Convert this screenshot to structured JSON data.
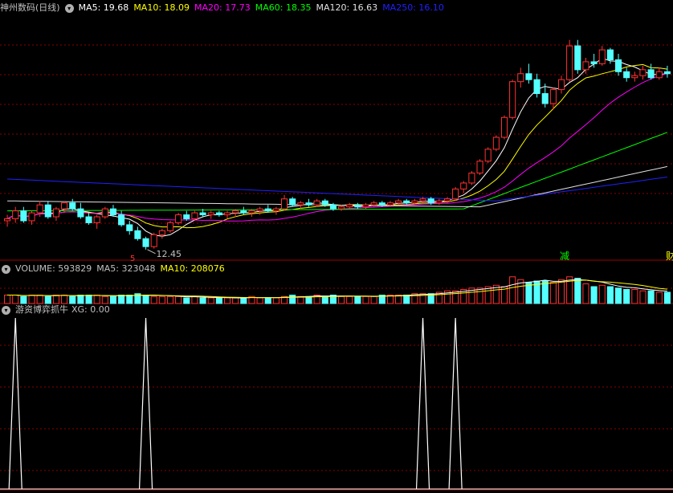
{
  "main_panel": {
    "title": "神州数码(日线)",
    "ma": [
      {
        "label": "MA5: 19.68",
        "color": "#ffffff"
      },
      {
        "label": "MA10: 18.09",
        "color": "#ffff00"
      },
      {
        "label": "MA20: 17.73",
        "color": "#ff00ff"
      },
      {
        "label": "MA60: 18.35",
        "color": "#00ff00"
      },
      {
        "label": "MA120: 16.63",
        "color": "#e0e0e0"
      },
      {
        "label": "MA250: 16.10",
        "color": "#2020ff"
      }
    ],
    "low_marker": "12.45",
    "signal_char": "5",
    "event_labels": [
      "减",
      "财"
    ],
    "colors": {
      "up": "#ff3232",
      "down": "#54ffff",
      "grid": "#8b0000"
    }
  },
  "volume_panel": {
    "labels": [
      {
        "text": "VOLUME: 593829",
        "color": "#c0c0c0"
      },
      {
        "text": "MA5: 323048",
        "color": "#c0c0c0"
      },
      {
        "text": "MA10: 208076",
        "color": "#ffff00"
      }
    ]
  },
  "indicator_panel": {
    "name": "游资博弈抓牛",
    "value_label": "XG: 0.00"
  },
  "chart_data": [
    {
      "type": "candlestick",
      "price_range": [
        12.0,
        24.2
      ],
      "low_annotation": 12.45,
      "candles": [
        [
          13.9,
          14.2,
          13.6,
          14.0
        ],
        [
          14.0,
          14.6,
          13.8,
          14.4
        ],
        [
          14.4,
          14.6,
          13.8,
          13.9
        ],
        [
          13.9,
          14.4,
          13.7,
          14.3
        ],
        [
          14.3,
          14.9,
          14.1,
          14.7
        ],
        [
          14.7,
          14.9,
          14.0,
          14.1
        ],
        [
          14.1,
          14.6,
          13.9,
          14.5
        ],
        [
          14.5,
          14.9,
          14.3,
          14.8
        ],
        [
          14.8,
          15.0,
          14.4,
          14.5
        ],
        [
          14.5,
          14.8,
          14.0,
          14.1
        ],
        [
          14.1,
          14.3,
          13.7,
          13.8
        ],
        [
          13.8,
          14.2,
          13.5,
          14.1
        ],
        [
          14.1,
          14.6,
          14.0,
          14.5
        ],
        [
          14.5,
          14.7,
          14.1,
          14.2
        ],
        [
          14.2,
          14.4,
          13.6,
          13.7
        ],
        [
          13.7,
          13.9,
          13.2,
          13.4
        ],
        [
          13.4,
          13.6,
          12.9,
          13.0
        ],
        [
          13.0,
          13.1,
          12.45,
          12.6
        ],
        [
          12.6,
          13.3,
          12.5,
          13.2
        ],
        [
          13.2,
          13.5,
          13.0,
          13.4
        ],
        [
          13.4,
          13.9,
          13.3,
          13.8
        ],
        [
          13.8,
          14.3,
          13.7,
          14.2
        ],
        [
          14.2,
          14.4,
          13.9,
          14.0
        ],
        [
          14.0,
          14.4,
          13.9,
          14.3
        ],
        [
          14.3,
          14.5,
          14.1,
          14.2
        ],
        [
          14.2,
          14.4,
          14.0,
          14.3
        ],
        [
          14.3,
          14.4,
          14.1,
          14.2
        ],
        [
          14.2,
          14.4,
          14.0,
          14.3
        ],
        [
          14.3,
          14.5,
          14.1,
          14.4
        ],
        [
          14.4,
          14.6,
          14.2,
          14.3
        ],
        [
          14.3,
          14.5,
          14.1,
          14.4
        ],
        [
          14.4,
          14.6,
          14.2,
          14.5
        ],
        [
          14.5,
          14.7,
          14.3,
          14.4
        ],
        [
          14.4,
          14.6,
          14.2,
          14.5
        ],
        [
          14.5,
          15.2,
          14.4,
          15.0
        ],
        [
          15.0,
          15.1,
          14.6,
          14.7
        ],
        [
          14.7,
          14.9,
          14.5,
          14.8
        ],
        [
          14.8,
          15.0,
          14.6,
          14.7
        ],
        [
          14.7,
          15.0,
          14.6,
          14.9
        ],
        [
          14.9,
          15.0,
          14.6,
          14.7
        ],
        [
          14.7,
          14.8,
          14.4,
          14.5
        ],
        [
          14.5,
          14.7,
          14.4,
          14.6
        ],
        [
          14.6,
          14.8,
          14.5,
          14.7
        ],
        [
          14.7,
          14.8,
          14.5,
          14.6
        ],
        [
          14.6,
          14.8,
          14.5,
          14.7
        ],
        [
          14.7,
          14.9,
          14.6,
          14.8
        ],
        [
          14.8,
          14.9,
          14.6,
          14.7
        ],
        [
          14.7,
          14.9,
          14.6,
          14.8
        ],
        [
          14.8,
          15.0,
          14.7,
          14.9
        ],
        [
          14.9,
          15.0,
          14.7,
          14.8
        ],
        [
          14.8,
          15.0,
          14.7,
          14.9
        ],
        [
          14.9,
          15.1,
          14.8,
          15.0
        ],
        [
          15.0,
          15.1,
          14.7,
          14.8
        ],
        [
          14.8,
          15.0,
          14.7,
          14.9
        ],
        [
          14.9,
          15.1,
          14.8,
          15.0
        ],
        [
          15.0,
          15.6,
          14.9,
          15.5
        ],
        [
          15.5,
          15.9,
          15.3,
          15.8
        ],
        [
          15.8,
          16.4,
          15.7,
          16.3
        ],
        [
          16.3,
          17.0,
          16.2,
          16.9
        ],
        [
          16.9,
          17.6,
          16.8,
          17.5
        ],
        [
          17.5,
          18.2,
          17.4,
          18.1
        ],
        [
          18.1,
          19.2,
          18.0,
          19.1
        ],
        [
          19.1,
          21.0,
          19.0,
          20.9
        ],
        [
          20.9,
          21.6,
          20.6,
          21.3
        ],
        [
          21.3,
          21.8,
          20.8,
          21.0
        ],
        [
          21.0,
          21.3,
          20.1,
          20.3
        ],
        [
          20.3,
          20.8,
          19.6,
          19.8
        ],
        [
          19.8,
          20.6,
          19.5,
          20.5
        ],
        [
          20.5,
          21.2,
          20.3,
          21.0
        ],
        [
          21.0,
          23.0,
          20.9,
          22.7
        ],
        [
          22.7,
          23.0,
          21.3,
          21.5
        ],
        [
          21.5,
          22.1,
          21.3,
          21.9
        ],
        [
          21.9,
          22.3,
          21.6,
          21.8
        ],
        [
          21.8,
          22.7,
          21.7,
          22.5
        ],
        [
          22.5,
          22.6,
          21.8,
          22.0
        ],
        [
          22.0,
          22.3,
          21.2,
          21.4
        ],
        [
          21.4,
          21.6,
          20.9,
          21.1
        ],
        [
          21.1,
          21.4,
          20.9,
          21.2
        ],
        [
          21.2,
          21.7,
          21.0,
          21.5
        ],
        [
          21.5,
          21.8,
          21.0,
          21.1
        ],
        [
          21.1,
          21.6,
          21.0,
          21.4
        ],
        [
          21.4,
          21.7,
          21.1,
          21.3
        ]
      ],
      "ma_lines": {
        "MA5": 19.68,
        "MA10": 18.09,
        "MA20": 17.73,
        "MA60": 18.35,
        "MA120": 16.63,
        "MA250": 16.1
      }
    },
    {
      "type": "bar",
      "series": [
        {
          "name": "VOLUME",
          "last": 593829
        },
        {
          "name": "MA5",
          "last": 323048
        },
        {
          "name": "MA10",
          "last": 208076
        }
      ],
      "relative_values": [
        0.3,
        0.3,
        0.25,
        0.3,
        0.3,
        0.25,
        0.3,
        0.3,
        0.25,
        0.3,
        0.3,
        0.3,
        0.25,
        0.25,
        0.3,
        0.3,
        0.35,
        0.3,
        0.25,
        0.25,
        0.25,
        0.25,
        0.2,
        0.25,
        0.2,
        0.2,
        0.2,
        0.2,
        0.2,
        0.2,
        0.25,
        0.2,
        0.2,
        0.2,
        0.25,
        0.3,
        0.25,
        0.25,
        0.3,
        0.25,
        0.3,
        0.25,
        0.25,
        0.25,
        0.25,
        0.25,
        0.3,
        0.3,
        0.3,
        0.3,
        0.35,
        0.35,
        0.35,
        0.4,
        0.45,
        0.45,
        0.5,
        0.55,
        0.55,
        0.6,
        0.65,
        0.6,
        0.95,
        0.85,
        0.75,
        0.8,
        0.8,
        0.75,
        0.85,
        0.95,
        0.9,
        0.7,
        0.6,
        0.65,
        0.6,
        0.55,
        0.5,
        0.5,
        0.45,
        0.45,
        0.4,
        0.4
      ]
    },
    {
      "type": "line",
      "series": [
        {
          "name": "XG",
          "values": [
            0,
            1,
            0,
            0,
            0,
            0,
            1,
            0,
            0,
            0,
            0,
            0,
            0,
            0,
            0,
            0,
            0,
            0,
            0,
            0,
            0,
            0,
            0,
            0,
            0,
            0,
            0,
            0,
            0,
            0,
            0,
            0,
            0,
            0,
            0,
            0,
            0,
            1,
            0,
            1,
            0,
            0,
            0,
            0,
            0,
            0,
            0,
            0,
            0,
            0,
            0,
            0,
            0,
            0,
            0,
            0,
            0,
            0,
            0,
            0,
            0,
            0
          ]
        }
      ],
      "spike_candle_index": [
        1,
        17,
        51,
        55
      ],
      "ylim": [
        0,
        1
      ]
    }
  ]
}
